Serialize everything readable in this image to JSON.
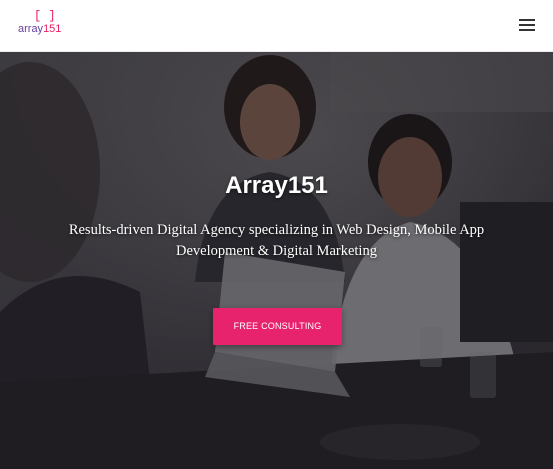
{
  "header": {
    "logo": {
      "brackets": "[ ]",
      "wordmark": "array",
      "number": "151"
    },
    "menu_icon": "hamburger-menu-icon"
  },
  "hero": {
    "title": "Array151",
    "subtitle": "Results-driven Digital Agency specializing in Web Design, Mobile App Development & Digital Marketing",
    "cta_label": "FREE CONSULTING"
  },
  "colors": {
    "accent": "#e8236e",
    "logo_purple": "#6a3fa0",
    "overlay": "#16141a"
  }
}
